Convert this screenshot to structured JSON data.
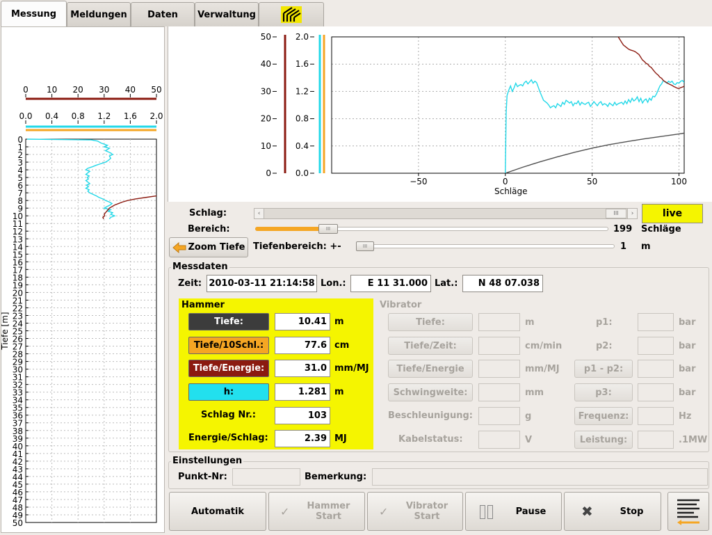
{
  "tabs": [
    {
      "label": "Messung"
    },
    {
      "label": "Meldungen"
    },
    {
      "label": "Daten"
    },
    {
      "label": "Verwaltung"
    }
  ],
  "logo_icon": "company-logo",
  "depth_plot": {
    "axis1_ticks": [
      "0",
      "10",
      "20",
      "30",
      "40",
      "50"
    ],
    "axis2_ticks": [
      "0.0",
      "0.4",
      "0.8",
      "1.2",
      "1.6",
      "2.0"
    ],
    "ylabel": "Tiefe [m]",
    "depth_ticks": [
      "0",
      "1",
      "2",
      "3",
      "4",
      "5",
      "6",
      "7",
      "8",
      "9",
      "10",
      "11",
      "12",
      "13",
      "14",
      "15",
      "16",
      "17",
      "18",
      "19",
      "20",
      "21",
      "22",
      "23",
      "24",
      "25",
      "26",
      "27",
      "28",
      "29",
      "30",
      "31",
      "32",
      "33",
      "34",
      "35",
      "36",
      "37",
      "38",
      "39",
      "40",
      "41",
      "42",
      "43",
      "44",
      "45",
      "46",
      "47",
      "48",
      "49",
      "50"
    ],
    "colors": {
      "brown": "#8b1a10",
      "cyan": "#22d8e8",
      "orange": "#f5a623"
    }
  },
  "chart_data": [
    {
      "type": "line",
      "title": "",
      "xlabel": "Schläge",
      "xlim": [
        -100,
        103
      ],
      "x_ticks": [
        "−50",
        "0",
        "50",
        "100"
      ],
      "y_left_ticks": [
        "0",
        "10",
        "20",
        "30",
        "40",
        "50"
      ],
      "y_right_ticks": [
        "0.0",
        "0.4",
        "0.8",
        "1.2",
        "1.6",
        "2.0"
      ],
      "grid": true,
      "series": [
        {
          "color": "#22d8e8",
          "x": [
            0,
            0.5,
            1,
            2,
            3,
            4,
            5,
            6,
            7,
            8,
            9,
            10,
            11,
            12,
            13,
            14,
            15,
            16,
            17,
            18,
            19,
            20,
            21,
            22,
            23,
            24,
            25,
            26,
            27,
            28,
            29,
            30,
            31,
            32,
            33,
            34,
            35,
            36,
            37,
            38,
            39,
            40,
            41,
            42,
            43,
            44,
            45,
            46,
            47,
            48,
            49,
            50,
            51,
            52,
            53,
            54,
            55,
            56,
            57,
            58,
            59,
            60,
            61,
            62,
            63,
            64,
            65,
            66,
            67,
            68,
            69,
            70,
            71,
            72,
            73,
            74,
            75,
            76,
            77,
            78,
            79,
            80,
            81,
            82,
            83,
            84,
            85,
            86,
            87,
            88,
            89,
            90,
            91,
            92,
            93,
            94,
            95,
            96,
            97,
            98,
            99,
            100,
            101,
            102,
            103
          ],
          "y": [
            0,
            0.9,
            1.14,
            1.22,
            1.28,
            1.2,
            1.25,
            1.32,
            1.27,
            1.29,
            1.3,
            1.28,
            1.33,
            1.35,
            1.31,
            1.34,
            1.37,
            1.32,
            1.35,
            1.33,
            1.26,
            1.19,
            1.13,
            1.07,
            1.05,
            1.03,
            1.0,
            0.96,
            0.98,
            0.99,
            0.96,
            1.02,
            1.0,
            0.98,
            1.04,
            1.01,
            1.07,
            1.05,
            1.03,
            1.05,
            0.99,
            1.03,
            1.02,
            1.06,
            1.0,
            1.04,
            1.02,
            1.01,
            1.03,
            1.04,
            0.98,
            1.01,
            1.05,
            1.02,
            0.99,
            1.03,
            1.05,
            1.0,
            1.02,
            1.01,
            0.98,
            1.03,
            1.01,
            0.99,
            1.04,
            1.0,
            1.02,
            1.03,
            1.04,
            1.01,
            1.06,
            1.02,
            1.08,
            1.04,
            1.1,
            1.06,
            1.08,
            1.12,
            1.05,
            1.1,
            1.03,
            1.07,
            1.09,
            1.04,
            1.1,
            1.07,
            1.13,
            1.12,
            1.16,
            1.22,
            1.28,
            1.31,
            1.36,
            1.34,
            1.32,
            1.35,
            1.33,
            1.35,
            1.31,
            1.3,
            1.33,
            1.32,
            1.35,
            1.36,
            1.33
          ]
        },
        {
          "color": "#8b1a10",
          "x": [
            65,
            66,
            67,
            68,
            69,
            70,
            71,
            72,
            73,
            74,
            75,
            76,
            77,
            78,
            79,
            80,
            81,
            82,
            83,
            84,
            85,
            86,
            87,
            88,
            89,
            90,
            91,
            92,
            93,
            94,
            95,
            96,
            97,
            98,
            99,
            100,
            101,
            102,
            103
          ],
          "y": [
            50,
            49,
            48,
            47,
            46.5,
            46,
            45.5,
            45.2,
            45,
            44.8,
            44.5,
            44,
            43.5,
            42.5,
            41.5,
            41,
            40.3,
            40,
            39.2,
            38.8,
            38,
            37.2,
            36.5,
            36,
            35.2,
            34.8,
            34,
            33.6,
            33.2,
            32.8,
            32.5,
            32.2,
            31.8,
            31.5,
            31.2,
            31.1,
            31.4,
            31.6,
            31.9
          ]
        },
        {
          "color": "#505050",
          "x": [
            0,
            10,
            20,
            30,
            40,
            50,
            60,
            70,
            80,
            90,
            100,
            103
          ],
          "y": [
            0,
            2.2,
            4.2,
            6,
            7.7,
            9.2,
            10.5,
            11.6,
            12.6,
            13.5,
            14.4,
            14.7
          ]
        }
      ]
    }
  ],
  "controls": {
    "schlag_label": "Schlag:",
    "bereich_label": "Bereich:",
    "live_label": "live",
    "bereich_value": "199",
    "bereich_unit": "Schläge",
    "zoom_label": "Zoom Tiefe",
    "tiefenbereich_label": "Tiefenbereich: +-",
    "tiefenbereich_value": "1",
    "tiefenbereich_unit": "m"
  },
  "messdaten": {
    "title": "Messdaten",
    "zeit_label": "Zeit:",
    "zeit_value": "2010-03-11 21:14:58",
    "lon_label": "Lon.:",
    "lon_value": "E 11 31.000",
    "lat_label": "Lat.:",
    "lat_value": "N 48 07.038"
  },
  "hammer": {
    "title": "Hammer",
    "rows": [
      {
        "label": "Tiefe:",
        "value": "10.41",
        "unit": "m"
      },
      {
        "label": "Tiefe/10Schl.:",
        "value": "77.6",
        "unit": "cm"
      },
      {
        "label": "Tiefe/Energie:",
        "value": "31.0",
        "unit": "mm/MJ"
      },
      {
        "label": "h:",
        "value": "1.281",
        "unit": "m"
      },
      {
        "label": "Schlag Nr.:",
        "value": "103",
        "unit": ""
      },
      {
        "label": "Energie/Schlag:",
        "value": "2.39",
        "unit": "MJ"
      }
    ]
  },
  "vibrator": {
    "title": "Vibrator",
    "left": [
      {
        "label": "Tiefe:",
        "unit": "m"
      },
      {
        "label": "Tiefe/Zeit:",
        "unit": "cm/min"
      },
      {
        "label": "Tiefe/Energie",
        "unit": "mm/MJ"
      },
      {
        "label": "Schwingweite:",
        "unit": "mm"
      },
      {
        "label": "Beschleunigung:",
        "unit": "g"
      },
      {
        "label": "Kabelstatus:",
        "unit": "V"
      }
    ],
    "right": [
      {
        "label": "p1:",
        "unit": "bar"
      },
      {
        "label": "p2:",
        "unit": "bar"
      },
      {
        "label": "p1 - p2:",
        "unit": "bar"
      },
      {
        "label": "p3:",
        "unit": "bar"
      },
      {
        "label": "Frequenz:",
        "unit": "Hz"
      },
      {
        "label": "Leistung:",
        "unit": ".1MW"
      }
    ]
  },
  "einstellungen": {
    "title": "Einstellungen",
    "punkt_label": "Punkt-Nr:",
    "bemerkung_label": "Bemerkung:"
  },
  "bottom": {
    "automatik": "Automatik",
    "hammer_start": "Hammer Start",
    "vibrator_start": "Vibrator Start",
    "pause": "Pause",
    "stop": "Stop"
  }
}
